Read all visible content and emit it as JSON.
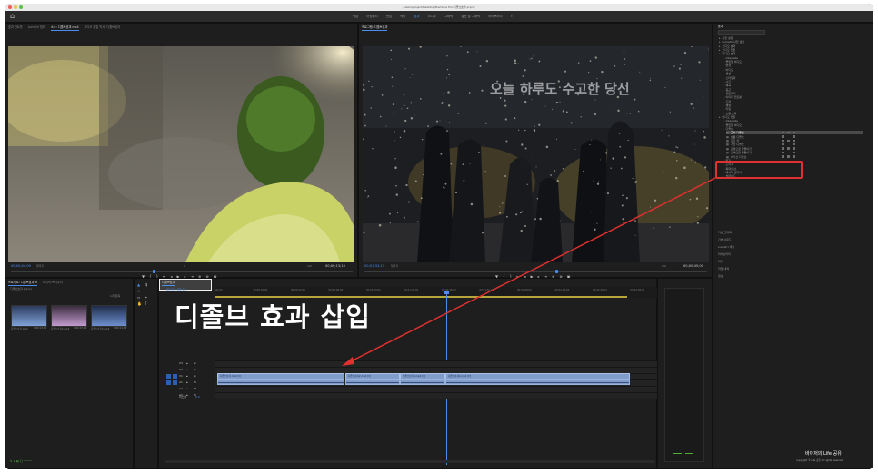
{
  "window": {
    "title": "/Users/project/Desktop/Premiere Pro/디졸브효과.prproj",
    "workspaces": [
      "학습",
      "어셈블리",
      "편집",
      "색상",
      "효과",
      "오디오",
      "그래픽",
      "캡션 및 그래픽",
      "라이브러리",
      "»"
    ],
    "active_workspace": "효과"
  },
  "source_monitor": {
    "tabs": [
      "효과 컨트롤",
      "Lumetri 범위",
      "소스: 디졸브효과.mp4",
      "오디오 클립 믹서: 디졸브효과"
    ],
    "active_tab": 2,
    "timecode_left": "00;00;04;09",
    "fit": "맞추기",
    "zoom": "1/2",
    "timecode_right": "00;00;13;10",
    "timeline_marker": "1"
  },
  "program_monitor": {
    "tabs": [
      "프로그램: 디졸브효과"
    ],
    "active_tab": 0,
    "video_caption": "오늘 하루도 수고한 당신",
    "timecode_left": "00;01;33;13",
    "fit": "맞추기",
    "zoom": "1/2",
    "timecode_right": "00;00;45;00"
  },
  "effects_panel": {
    "title": "효과",
    "items": [
      "사전 설정",
      "Lumetri 사전 설정",
      "오디오 효과",
      "오디오 전환",
      "비디오 효과",
      "Obsolete",
      "몰입형 비디오",
      "변형",
      "비디오",
      "생성",
      "스타일화",
      "시간",
      "왜곡",
      "원근",
      "유틸리티",
      "이미지 컨트롤",
      "조정",
      "채널",
      "키잉",
      "흐림 효과",
      "비디오 전환",
      "Obsolete",
      "몰입형 비디오",
      "디졸브",
      "교차 디졸브",
      "필름 디졸브",
      "모프 컷",
      "가산 디졸브",
      "검정으로 물들이기",
      "흰색으로 물들이기",
      "비가산 디졸브",
      "밀기",
      "조리개",
      "확대/축소",
      "페이지 벗기기",
      "슬라이드"
    ],
    "highlighted_item": "교차 디졸브",
    "sub_panels": [
      "기본 그래픽",
      "기본 사운드",
      "Lumetri 색상",
      "라이브러리",
      "마커",
      "작업 내역",
      "정보"
    ]
  },
  "project_panel": {
    "tabs": [
      "프로젝트: 디졸브효과 ≡",
      "미디어 브라우저"
    ],
    "path": "디졸브효과.prproj",
    "count": "1개 항목",
    "clips": [
      {
        "name": "디졸브효과.mp4",
        "duration": "0;00;13;10"
      },
      {
        "name": "디졸브효과2.mp4",
        "duration": "0;00;07;23"
      },
      {
        "name": "디졸브효과3.mp4",
        "duration": "0;00;11;18"
      }
    ]
  },
  "timeline": {
    "tab": "디졸브효과",
    "timecode": "00;01;33;13",
    "ruler": [
      "00;00",
      "00;00;16;00",
      "00;00;32;00",
      "00;00;48;00",
      "00;01;04;02",
      "00;01;20;02",
      "00;01;36;02",
      "00;01;52;02",
      "00;02;08;04",
      "00;02;24;04",
      "00;02;40;04",
      "00;02;56;04"
    ],
    "tracks": [
      {
        "id": "V3",
        "type": "video"
      },
      {
        "id": "V2",
        "type": "video"
      },
      {
        "id": "V1",
        "type": "video"
      },
      {
        "id": "A1",
        "type": "audio"
      },
      {
        "id": "A2",
        "type": "audio"
      },
      {
        "id": "A3",
        "type": "audio"
      }
    ],
    "master": "마스터",
    "master_value": "0.0",
    "clips": [
      "디졸브효과.mp4 [V]",
      "디졸브효과2.mp4 [V]",
      "디졸브효과3.mp4 [V]",
      "디졸브효과4.mp4 [V]"
    ]
  },
  "annotation": {
    "label": "디졸브 효과 삽입"
  },
  "watermark": {
    "brand": "바이저의 Life 공유",
    "sub": "copyright © Life 공유 All rights reserved"
  },
  "colors": {
    "accent": "#4a8ff0",
    "highlight": "#e0302f",
    "clip": "#7f9ccb"
  }
}
